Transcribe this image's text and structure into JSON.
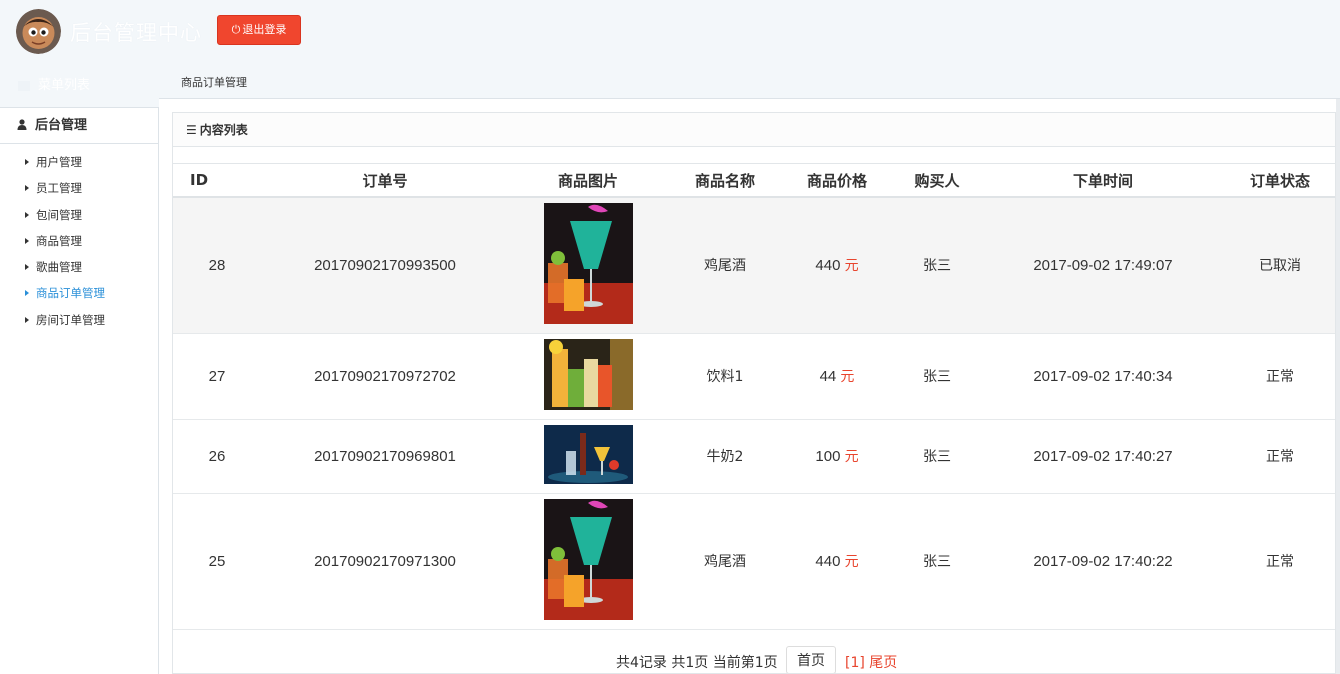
{
  "header": {
    "app_title": "后台管理中心",
    "logout_label": "退出登录"
  },
  "menu_list_label": "菜单列表",
  "sidebar": {
    "section_title": "后台管理",
    "items": [
      {
        "label": "用户管理"
      },
      {
        "label": "员工管理"
      },
      {
        "label": "包间管理"
      },
      {
        "label": "商品管理"
      },
      {
        "label": "歌曲管理"
      },
      {
        "label": "商品订单管理",
        "active": true
      },
      {
        "label": "房间订单管理"
      }
    ]
  },
  "breadcrumb": "商品订单管理",
  "panel_title": "内容列表",
  "table": {
    "columns": [
      "ID",
      "订单号",
      "商品图片",
      "商品名称",
      "商品价格",
      "购买人",
      "下单时间",
      "订单状态"
    ],
    "currency": "元",
    "rows": [
      {
        "id": "28",
        "order_no": "20170902170993500",
        "image": "cocktail-image",
        "name": "鸡尾酒",
        "price": "440",
        "buyer": "张三",
        "time": "2017-09-02 17:49:07",
        "status": "已取消"
      },
      {
        "id": "27",
        "order_no": "20170902170972702",
        "image": "juice-image",
        "name": "饮料1",
        "price": "44",
        "buyer": "张三",
        "time": "2017-09-02 17:40:34",
        "status": "正常"
      },
      {
        "id": "26",
        "order_no": "20170902170969801",
        "image": "drinks-image",
        "name": "牛奶2",
        "price": "100",
        "buyer": "张三",
        "time": "2017-09-02 17:40:27",
        "status": "正常"
      },
      {
        "id": "25",
        "order_no": "20170902170971300",
        "image": "cocktail-image",
        "name": "鸡尾酒",
        "price": "440",
        "buyer": "张三",
        "time": "2017-09-02 17:40:22",
        "status": "正常"
      }
    ]
  },
  "pagination": {
    "summary": "共4记录 共1页 当前第1页",
    "first_label": "首页",
    "current_label": "[1] 尾页"
  },
  "colors": {
    "logout_bg": "#f0462e",
    "active_link": "#2a8fd8",
    "currency": "#e8452e"
  }
}
